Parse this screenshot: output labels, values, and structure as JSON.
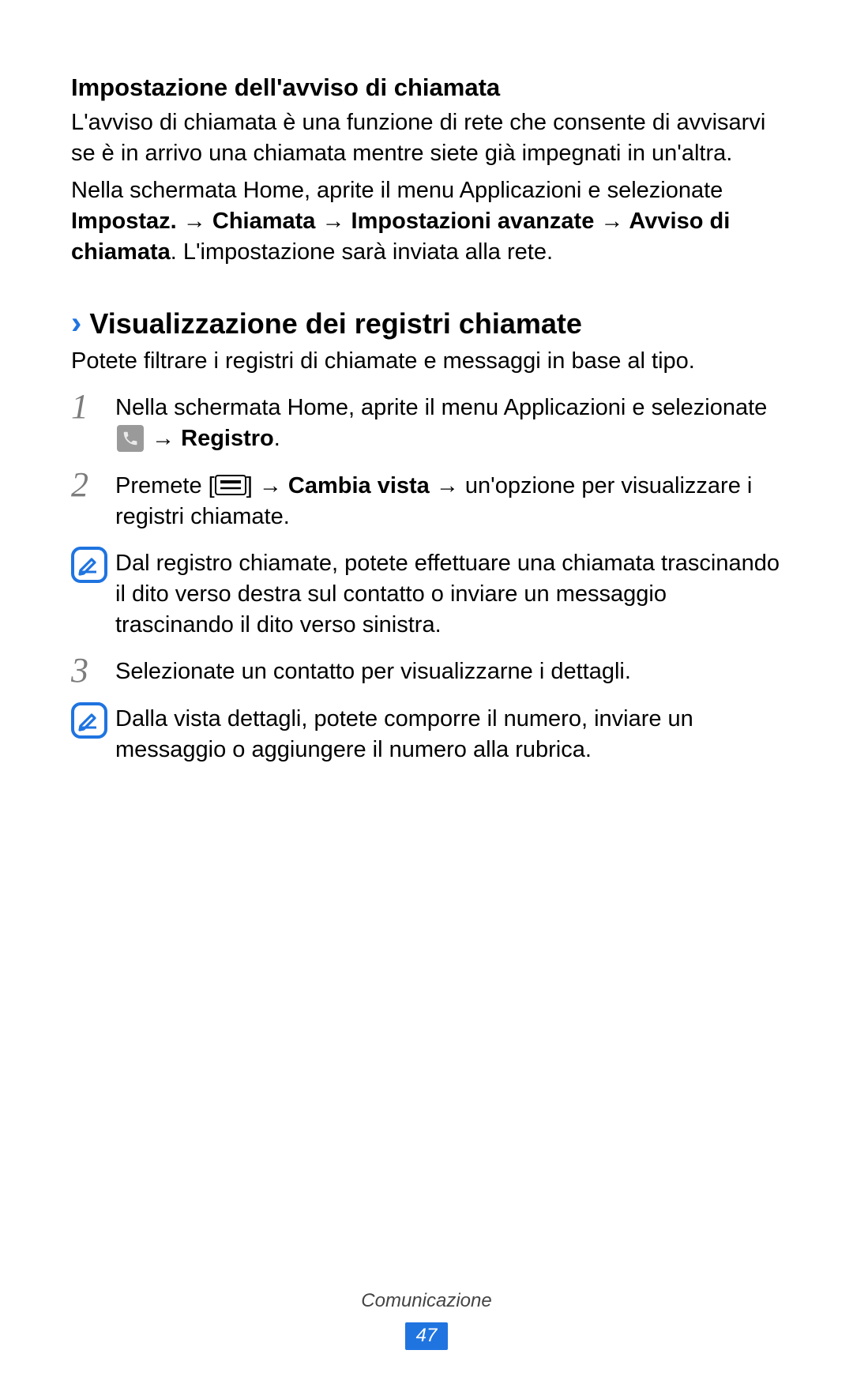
{
  "section1": {
    "title": "Impostazione dell'avviso di chiamata",
    "p1": "L'avviso di chiamata è una funzione di rete che consente di avvisarvi se è in arrivo una chiamata mentre siete già impegnati in un'altra.",
    "p2a": "Nella schermata Home, aprite il menu Applicazioni e selezionate ",
    "p2b": "Impostaz.",
    "arrow": " → ",
    "p2c": "Chiamata",
    "p2d": "Impostazioni avanzate",
    "p2e": "Avviso di chiamata",
    "p2f": ". L'impostazione sarà inviata alla rete."
  },
  "section2": {
    "title": "Visualizzazione dei registri chiamate",
    "intro": "Potete filtrare i registri di chiamate e messaggi in base al tipo.",
    "steps": {
      "1": {
        "num": "1",
        "a": "Nella schermata Home, aprite il menu Applicazioni e selezionate ",
        "b": "Registro",
        "c": "."
      },
      "2": {
        "num": "2",
        "a": "Premete [",
        "b": "] → ",
        "c": "Cambia vista",
        "d": " → un'opzione per visualizzare i registri chiamate."
      },
      "3": {
        "num": "3",
        "text": "Selezionate un contatto per visualizzarne i dettagli."
      }
    },
    "notes": {
      "1": "Dal registro chiamate, potete effettuare una chiamata trascinando il dito verso destra sul contatto o inviare un messaggio trascinando il dito verso sinistra.",
      "2": "Dalla vista dettagli, potete comporre il numero, inviare un messaggio o aggiungere il numero alla rubrica."
    }
  },
  "footer": {
    "label": "Comunicazione",
    "page": "47"
  }
}
